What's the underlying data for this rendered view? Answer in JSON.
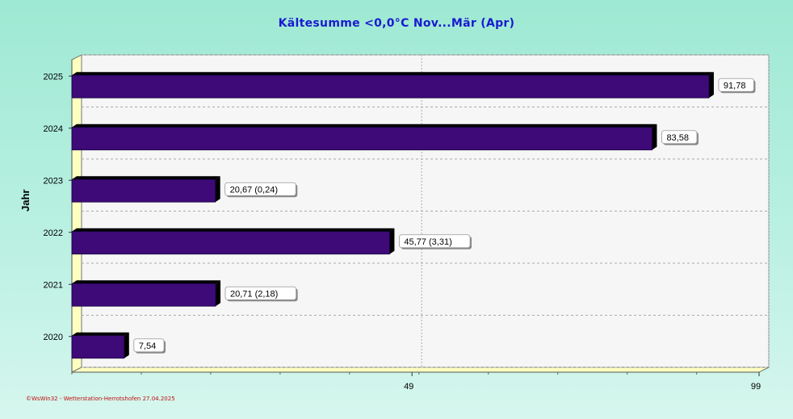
{
  "chart_data": {
    "type": "bar",
    "orientation": "horizontal",
    "title": "Kältesumme  <0,0°C  Nov...Mär (Apr)",
    "ylabel": "Jahr",
    "xlabel": "",
    "categories": [
      "2025",
      "2024",
      "2023",
      "2022",
      "2021",
      "2020"
    ],
    "values": [
      91.78,
      83.58,
      20.67,
      45.77,
      20.71,
      7.54
    ],
    "data_labels": [
      "91,78",
      "83,58",
      "20,67 (0,24)",
      "45,77 (3,31)",
      "20,71 (2,18)",
      "7,54"
    ],
    "xlim": [
      0,
      99
    ],
    "x_ticks": [
      49,
      99
    ],
    "x_tick_labels": [
      "49",
      "99"
    ],
    "grid": true,
    "legend": "none",
    "colors": {
      "bar": "#3d0a78",
      "bar_shadow": "#000000",
      "plot_background": "#f6f6f6",
      "floor": "#ffffc0",
      "title": "#1a1ad0",
      "footer": "#c01010"
    }
  },
  "footer_text": "©WsWin32 - Wetterstation-Herrotshofen 27.04.2025"
}
